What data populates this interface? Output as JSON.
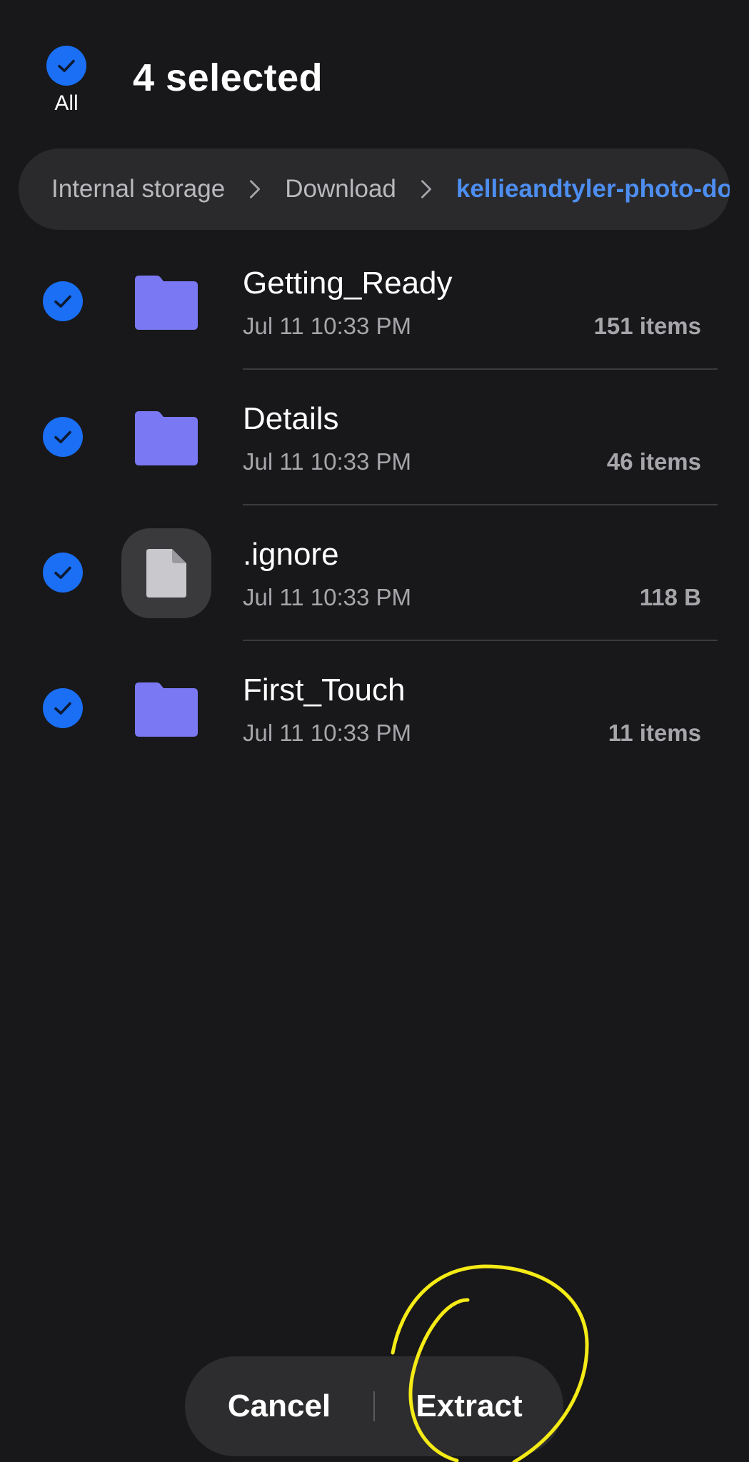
{
  "header": {
    "select_all_label": "All",
    "selected_title": "4 selected"
  },
  "breadcrumb": {
    "items": [
      "Internal storage",
      "Download",
      "kellieandtyler-photo-do"
    ]
  },
  "files": [
    {
      "name": "Getting_Ready",
      "date": "Jul 11 10:33 PM",
      "size": "151 items",
      "type": "folder",
      "checked": true
    },
    {
      "name": "Details",
      "date": "Jul 11 10:33 PM",
      "size": "46 items",
      "type": "folder",
      "checked": true
    },
    {
      "name": ".ignore",
      "date": "Jul 11 10:33 PM",
      "size": "118 B",
      "type": "file",
      "checked": true
    },
    {
      "name": "First_Touch",
      "date": "Jul 11 10:33 PM",
      "size": "11 items",
      "type": "folder",
      "checked": true
    }
  ],
  "actions": {
    "cancel_label": "Cancel",
    "extract_label": "Extract"
  },
  "colors": {
    "background": "#18181a",
    "accent": "#1a6ff5",
    "folder": "#7a78f2",
    "breadcrumb_current": "#4d8ef0",
    "annotation": "#f5eb16"
  },
  "icons": {
    "check": "check-circle-icon",
    "folder": "folder-icon",
    "file": "document-icon",
    "separator": "chevron-right-icon"
  }
}
